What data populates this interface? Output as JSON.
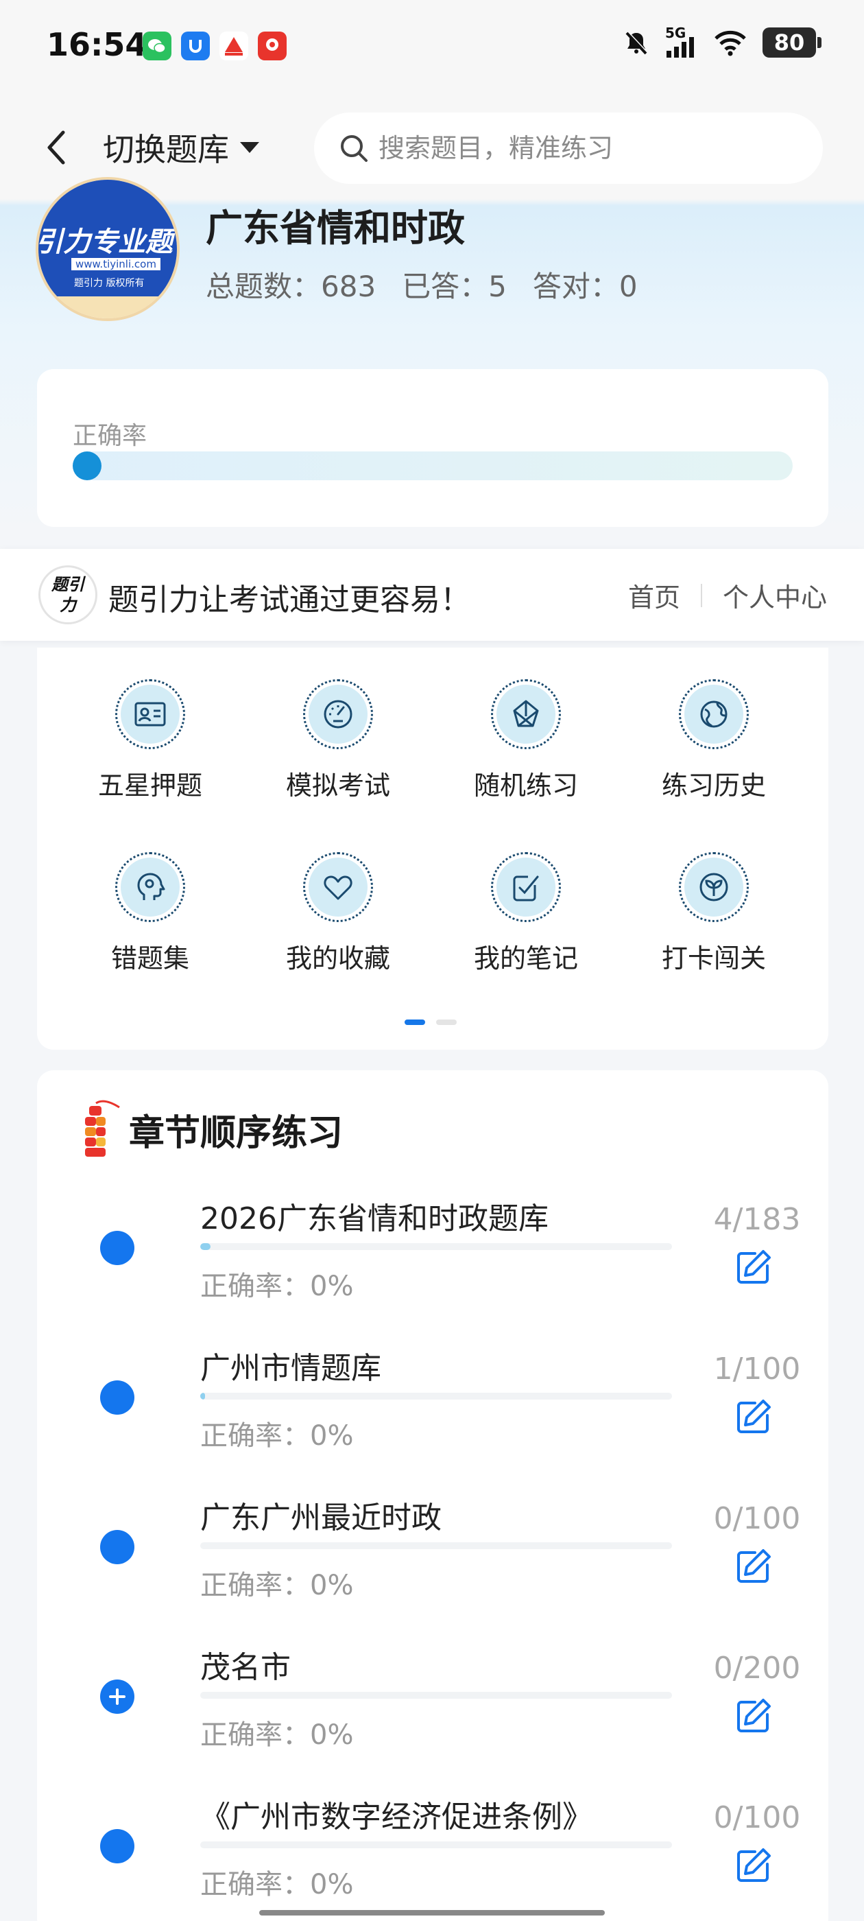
{
  "status_bar": {
    "time": "16:54",
    "network": "5G",
    "battery": "80",
    "app_icons": [
      "wechat-icon",
      "app-u-icon",
      "app-red-icon",
      "app-shop-icon"
    ]
  },
  "nav": {
    "title": "切换题库",
    "search_placeholder": "搜索题目，精准练习"
  },
  "bank": {
    "logo_text": "引力专业题",
    "logo_url": "www.tiyinli.com",
    "logo_copyright": "题引力 版权所有",
    "title": "广东省情和时政",
    "total": "总题数：683",
    "answered": "已答：5",
    "correct": "答对：0"
  },
  "accuracy": {
    "label": "正确率",
    "value_percent": 0
  },
  "banner": {
    "logo_text": "题引力",
    "text": "题引力让考试通过更容易！",
    "home_link": "首页",
    "profile_link": "个人中心"
  },
  "features": [
    {
      "label": "五星押题",
      "icon": "id-card-icon"
    },
    {
      "label": "模拟考试",
      "icon": "speedometer-icon"
    },
    {
      "label": "随机练习",
      "icon": "random-icon"
    },
    {
      "label": "练习历史",
      "icon": "globe-icon"
    },
    {
      "label": "错题集",
      "icon": "head-icon"
    },
    {
      "label": "我的收藏",
      "icon": "heart-icon"
    },
    {
      "label": "我的笔记",
      "icon": "note-check-icon"
    },
    {
      "label": "打卡闯关",
      "icon": "sprout-icon"
    }
  ],
  "pager": {
    "current": 1,
    "total": 2
  },
  "chapters": {
    "title": "章节顺序练习",
    "items": [
      {
        "name": "2026广东省情和时政题库",
        "accuracy": "正确率：0%",
        "count": "4/183",
        "progress": 0.022,
        "expandable": false
      },
      {
        "name": "广州市情题库",
        "accuracy": "正确率：0%",
        "count": "1/100",
        "progress": 0.01,
        "expandable": false
      },
      {
        "name": "广东广州最近时政",
        "accuracy": "正确率：0%",
        "count": "0/100",
        "progress": 0,
        "expandable": false
      },
      {
        "name": "茂名市",
        "accuracy": "正确率：0%",
        "count": "0/200",
        "progress": 0,
        "expandable": true
      },
      {
        "name": "《广州市数字经济促进条例》",
        "accuracy": "正确率：0%",
        "count": "0/100",
        "progress": 0,
        "expandable": false
      }
    ]
  },
  "colors": {
    "accent": "#1476ee",
    "icon_bg": "#d3ecf6",
    "icon_stroke": "#1a4a6e",
    "progress_fill": "#8fd0ef"
  }
}
